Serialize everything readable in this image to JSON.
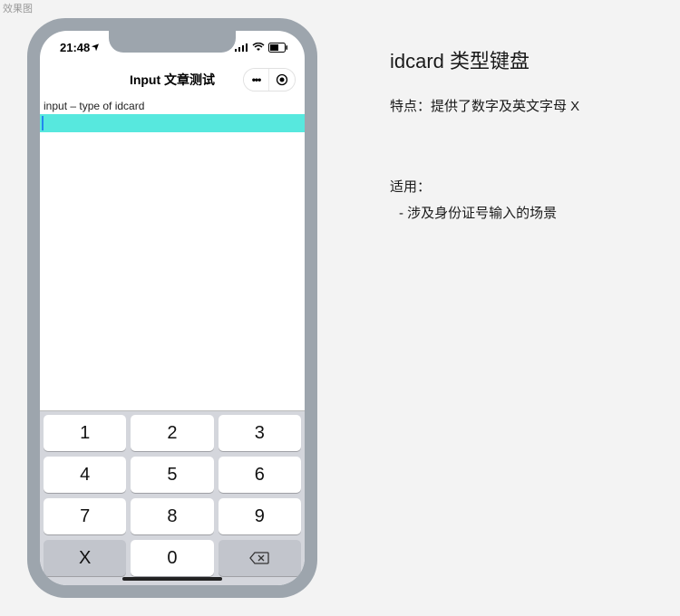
{
  "caption": "效果图",
  "phone": {
    "status": {
      "time": "21:48",
      "location_arrow": "➤"
    },
    "header": {
      "title": "Input 文章测试",
      "more": "•••",
      "close": "◉"
    },
    "content": {
      "label": "input – type of idcard"
    },
    "keyboard": {
      "rows": [
        [
          "1",
          "2",
          "3"
        ],
        [
          "4",
          "5",
          "6"
        ],
        [
          "7",
          "8",
          "9"
        ],
        [
          "X",
          "0",
          "⌫"
        ]
      ]
    }
  },
  "description": {
    "title": "idcard 类型键盘",
    "feature_label": "特点：",
    "feature_text": "提供了数字及英文字母 X",
    "usage_label": "适用：",
    "usage_item": "- 涉及身份证号输入的场景"
  }
}
